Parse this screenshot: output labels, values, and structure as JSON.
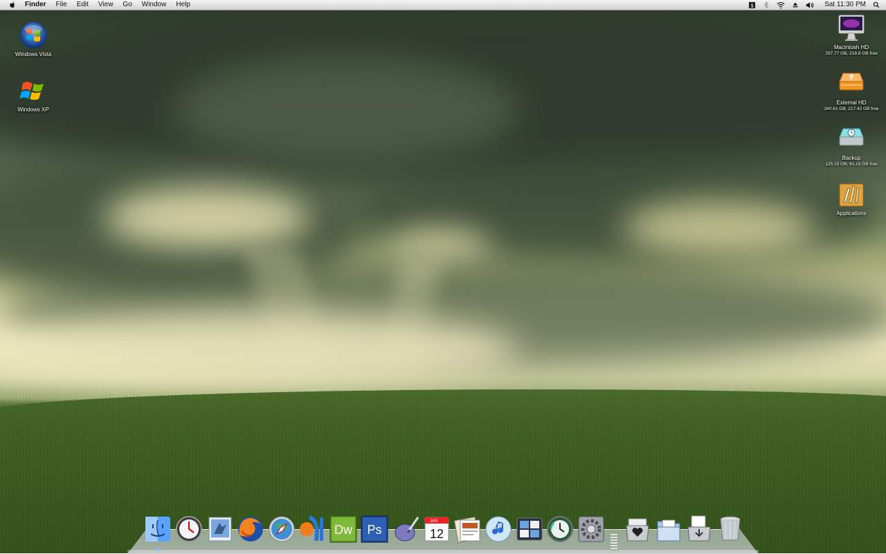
{
  "menubar": {
    "app_name": "Finder",
    "items": [
      "File",
      "Edit",
      "View",
      "Go",
      "Window",
      "Help"
    ],
    "clock": "Sat 11:30 PM",
    "status_icons": [
      "spaces-icon",
      "bluetooth-icon",
      "wifi-icon",
      "eject-icon",
      "volume-icon"
    ]
  },
  "desktop_left": [
    {
      "label": "Windows Vista"
    },
    {
      "label": "Windows XP"
    }
  ],
  "desktop_right": [
    {
      "label": "Macintosh HD",
      "info": "297.77 GB, 218.8 GB free"
    },
    {
      "label": "External HD",
      "info": "340.61 GB, 217.42 GB free"
    },
    {
      "label": "Backup",
      "info": "125.15 GB, 61.19 GB free"
    },
    {
      "label": "Applications"
    }
  ],
  "dock": {
    "apps": [
      "finder-icon",
      "clock-icon",
      "mail-icon",
      "firefox-icon",
      "safari-icon",
      "coda-icon",
      "dreamweaver-icon",
      "photoshop-icon",
      "script-editor-icon",
      "ical-icon",
      "preview-icon",
      "itunes-icon",
      "spaces-dock-icon",
      "time-machine-icon",
      "system-preferences-icon"
    ],
    "dw_text": "Dw",
    "ps_text": "Ps",
    "ical_month": "JAN",
    "ical_day": "12",
    "stacks": [
      "favorites-stack-icon",
      "documents-stack-icon",
      "downloads-stack-icon",
      "trash-icon"
    ]
  },
  "colors": {
    "menubar": "#e2e2e2",
    "wallpaper_grass": "#3f5e21",
    "wallpaper_sky": "#d8d7a6"
  }
}
